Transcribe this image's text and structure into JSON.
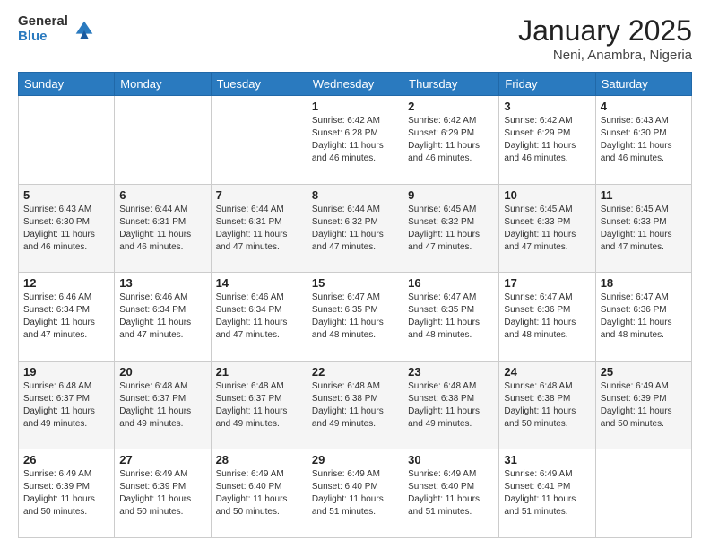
{
  "header": {
    "logo_general": "General",
    "logo_blue": "Blue",
    "month": "January 2025",
    "location": "Neni, Anambra, Nigeria"
  },
  "days_of_week": [
    "Sunday",
    "Monday",
    "Tuesday",
    "Wednesday",
    "Thursday",
    "Friday",
    "Saturday"
  ],
  "weeks": [
    [
      {
        "day": "",
        "sunrise": "",
        "sunset": "",
        "daylight": ""
      },
      {
        "day": "",
        "sunrise": "",
        "sunset": "",
        "daylight": ""
      },
      {
        "day": "",
        "sunrise": "",
        "sunset": "",
        "daylight": ""
      },
      {
        "day": "1",
        "sunrise": "Sunrise: 6:42 AM",
        "sunset": "Sunset: 6:28 PM",
        "daylight": "Daylight: 11 hours and 46 minutes."
      },
      {
        "day": "2",
        "sunrise": "Sunrise: 6:42 AM",
        "sunset": "Sunset: 6:29 PM",
        "daylight": "Daylight: 11 hours and 46 minutes."
      },
      {
        "day": "3",
        "sunrise": "Sunrise: 6:42 AM",
        "sunset": "Sunset: 6:29 PM",
        "daylight": "Daylight: 11 hours and 46 minutes."
      },
      {
        "day": "4",
        "sunrise": "Sunrise: 6:43 AM",
        "sunset": "Sunset: 6:30 PM",
        "daylight": "Daylight: 11 hours and 46 minutes."
      }
    ],
    [
      {
        "day": "5",
        "sunrise": "Sunrise: 6:43 AM",
        "sunset": "Sunset: 6:30 PM",
        "daylight": "Daylight: 11 hours and 46 minutes."
      },
      {
        "day": "6",
        "sunrise": "Sunrise: 6:44 AM",
        "sunset": "Sunset: 6:31 PM",
        "daylight": "Daylight: 11 hours and 46 minutes."
      },
      {
        "day": "7",
        "sunrise": "Sunrise: 6:44 AM",
        "sunset": "Sunset: 6:31 PM",
        "daylight": "Daylight: 11 hours and 47 minutes."
      },
      {
        "day": "8",
        "sunrise": "Sunrise: 6:44 AM",
        "sunset": "Sunset: 6:32 PM",
        "daylight": "Daylight: 11 hours and 47 minutes."
      },
      {
        "day": "9",
        "sunrise": "Sunrise: 6:45 AM",
        "sunset": "Sunset: 6:32 PM",
        "daylight": "Daylight: 11 hours and 47 minutes."
      },
      {
        "day": "10",
        "sunrise": "Sunrise: 6:45 AM",
        "sunset": "Sunset: 6:33 PM",
        "daylight": "Daylight: 11 hours and 47 minutes."
      },
      {
        "day": "11",
        "sunrise": "Sunrise: 6:45 AM",
        "sunset": "Sunset: 6:33 PM",
        "daylight": "Daylight: 11 hours and 47 minutes."
      }
    ],
    [
      {
        "day": "12",
        "sunrise": "Sunrise: 6:46 AM",
        "sunset": "Sunset: 6:34 PM",
        "daylight": "Daylight: 11 hours and 47 minutes."
      },
      {
        "day": "13",
        "sunrise": "Sunrise: 6:46 AM",
        "sunset": "Sunset: 6:34 PM",
        "daylight": "Daylight: 11 hours and 47 minutes."
      },
      {
        "day": "14",
        "sunrise": "Sunrise: 6:46 AM",
        "sunset": "Sunset: 6:34 PM",
        "daylight": "Daylight: 11 hours and 47 minutes."
      },
      {
        "day": "15",
        "sunrise": "Sunrise: 6:47 AM",
        "sunset": "Sunset: 6:35 PM",
        "daylight": "Daylight: 11 hours and 48 minutes."
      },
      {
        "day": "16",
        "sunrise": "Sunrise: 6:47 AM",
        "sunset": "Sunset: 6:35 PM",
        "daylight": "Daylight: 11 hours and 48 minutes."
      },
      {
        "day": "17",
        "sunrise": "Sunrise: 6:47 AM",
        "sunset": "Sunset: 6:36 PM",
        "daylight": "Daylight: 11 hours and 48 minutes."
      },
      {
        "day": "18",
        "sunrise": "Sunrise: 6:47 AM",
        "sunset": "Sunset: 6:36 PM",
        "daylight": "Daylight: 11 hours and 48 minutes."
      }
    ],
    [
      {
        "day": "19",
        "sunrise": "Sunrise: 6:48 AM",
        "sunset": "Sunset: 6:37 PM",
        "daylight": "Daylight: 11 hours and 49 minutes."
      },
      {
        "day": "20",
        "sunrise": "Sunrise: 6:48 AM",
        "sunset": "Sunset: 6:37 PM",
        "daylight": "Daylight: 11 hours and 49 minutes."
      },
      {
        "day": "21",
        "sunrise": "Sunrise: 6:48 AM",
        "sunset": "Sunset: 6:37 PM",
        "daylight": "Daylight: 11 hours and 49 minutes."
      },
      {
        "day": "22",
        "sunrise": "Sunrise: 6:48 AM",
        "sunset": "Sunset: 6:38 PM",
        "daylight": "Daylight: 11 hours and 49 minutes."
      },
      {
        "day": "23",
        "sunrise": "Sunrise: 6:48 AM",
        "sunset": "Sunset: 6:38 PM",
        "daylight": "Daylight: 11 hours and 49 minutes."
      },
      {
        "day": "24",
        "sunrise": "Sunrise: 6:48 AM",
        "sunset": "Sunset: 6:38 PM",
        "daylight": "Daylight: 11 hours and 50 minutes."
      },
      {
        "day": "25",
        "sunrise": "Sunrise: 6:49 AM",
        "sunset": "Sunset: 6:39 PM",
        "daylight": "Daylight: 11 hours and 50 minutes."
      }
    ],
    [
      {
        "day": "26",
        "sunrise": "Sunrise: 6:49 AM",
        "sunset": "Sunset: 6:39 PM",
        "daylight": "Daylight: 11 hours and 50 minutes."
      },
      {
        "day": "27",
        "sunrise": "Sunrise: 6:49 AM",
        "sunset": "Sunset: 6:39 PM",
        "daylight": "Daylight: 11 hours and 50 minutes."
      },
      {
        "day": "28",
        "sunrise": "Sunrise: 6:49 AM",
        "sunset": "Sunset: 6:40 PM",
        "daylight": "Daylight: 11 hours and 50 minutes."
      },
      {
        "day": "29",
        "sunrise": "Sunrise: 6:49 AM",
        "sunset": "Sunset: 6:40 PM",
        "daylight": "Daylight: 11 hours and 51 minutes."
      },
      {
        "day": "30",
        "sunrise": "Sunrise: 6:49 AM",
        "sunset": "Sunset: 6:40 PM",
        "daylight": "Daylight: 11 hours and 51 minutes."
      },
      {
        "day": "31",
        "sunrise": "Sunrise: 6:49 AM",
        "sunset": "Sunset: 6:41 PM",
        "daylight": "Daylight: 11 hours and 51 minutes."
      },
      {
        "day": "",
        "sunrise": "",
        "sunset": "",
        "daylight": ""
      }
    ]
  ]
}
